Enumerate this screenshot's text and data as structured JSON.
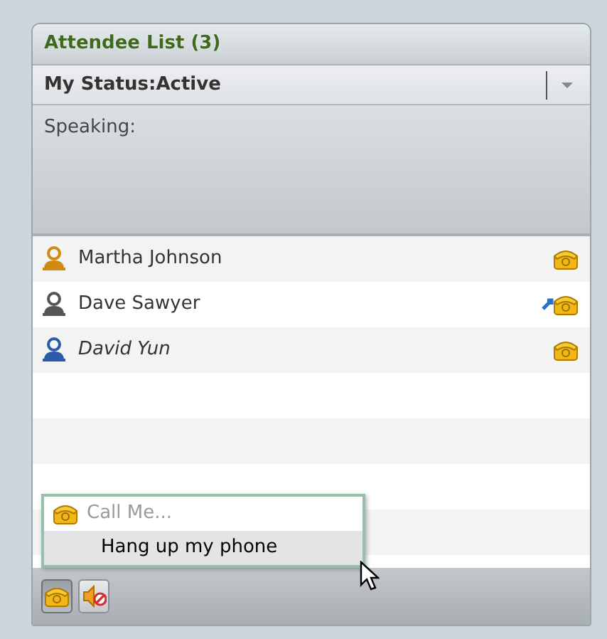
{
  "panel": {
    "title": "Attendee List (3)"
  },
  "status": {
    "label": "My Status:Active"
  },
  "speaking": {
    "label": "Speaking:"
  },
  "attendees": [
    {
      "name": "Martha Johnson",
      "color": "#d08a10",
      "italic": false,
      "kind": "phone"
    },
    {
      "name": "Dave Sawyer",
      "color": "#555555",
      "italic": false,
      "kind": "forwarded"
    },
    {
      "name": "David Yun",
      "color": "#2a5aa8",
      "italic": true,
      "kind": "phone"
    }
  ],
  "audio_menu": [
    {
      "label": "Call Me...",
      "kind": "phone",
      "disabled": true,
      "selected": false
    },
    {
      "label": "Hang up my phone",
      "kind": "plain",
      "disabled": false,
      "selected": true
    }
  ],
  "toolbar": [
    {
      "kind": "phone",
      "pressed": true
    },
    {
      "kind": "mute",
      "pressed": false
    }
  ]
}
